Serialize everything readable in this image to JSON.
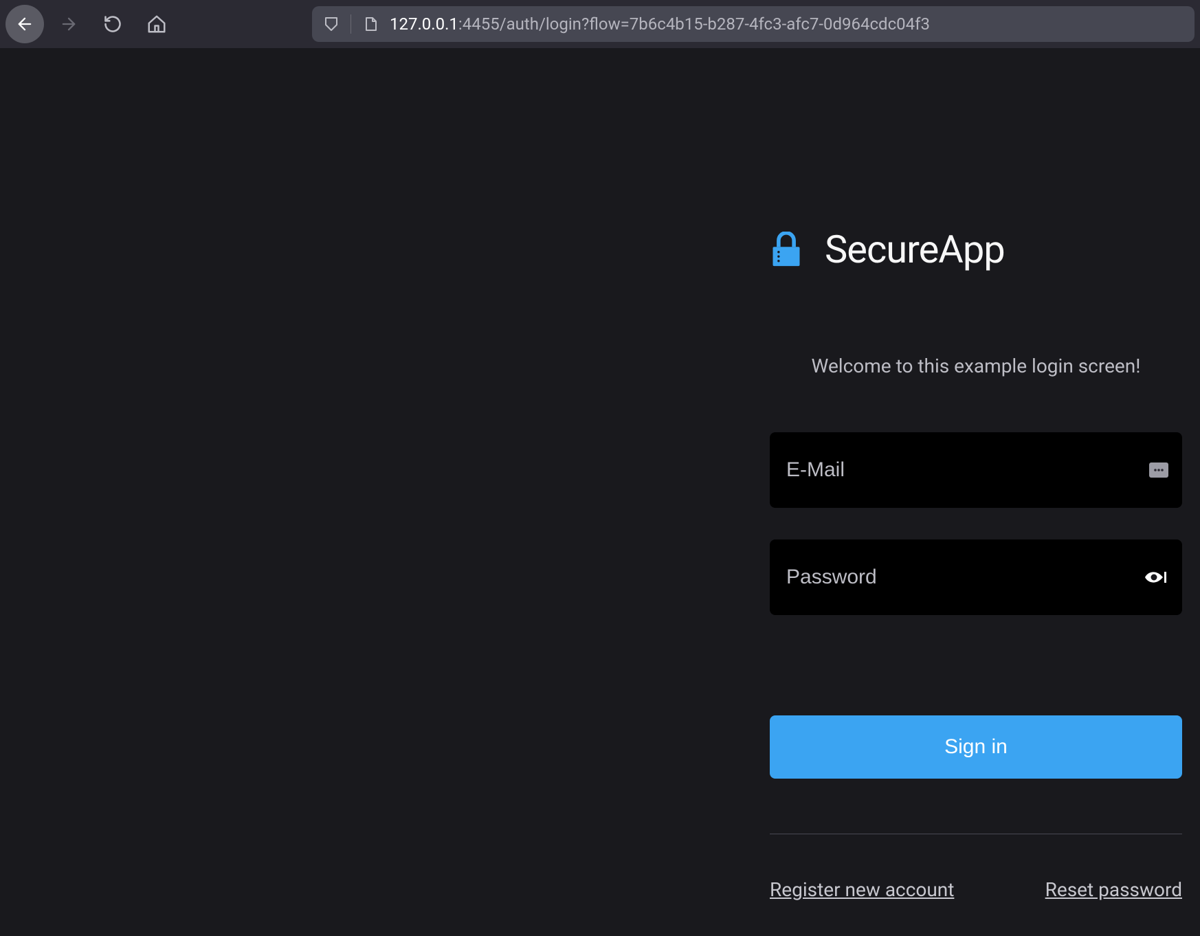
{
  "browser": {
    "url_host": "127.0.0.1",
    "url_rest": ":4455/auth/login?flow=7b6c4b15-b287-4fc3-afc7-0d964cdc04f3"
  },
  "page": {
    "app_title": "SecureApp",
    "welcome": "Welcome to this example login screen!",
    "email_placeholder": "E-Mail",
    "email_value": "",
    "password_placeholder": "Password",
    "password_value": "",
    "signin_label": "Sign in",
    "register_label": "Register new account",
    "reset_label": "Reset password",
    "accent_color": "#3ba4f2"
  }
}
